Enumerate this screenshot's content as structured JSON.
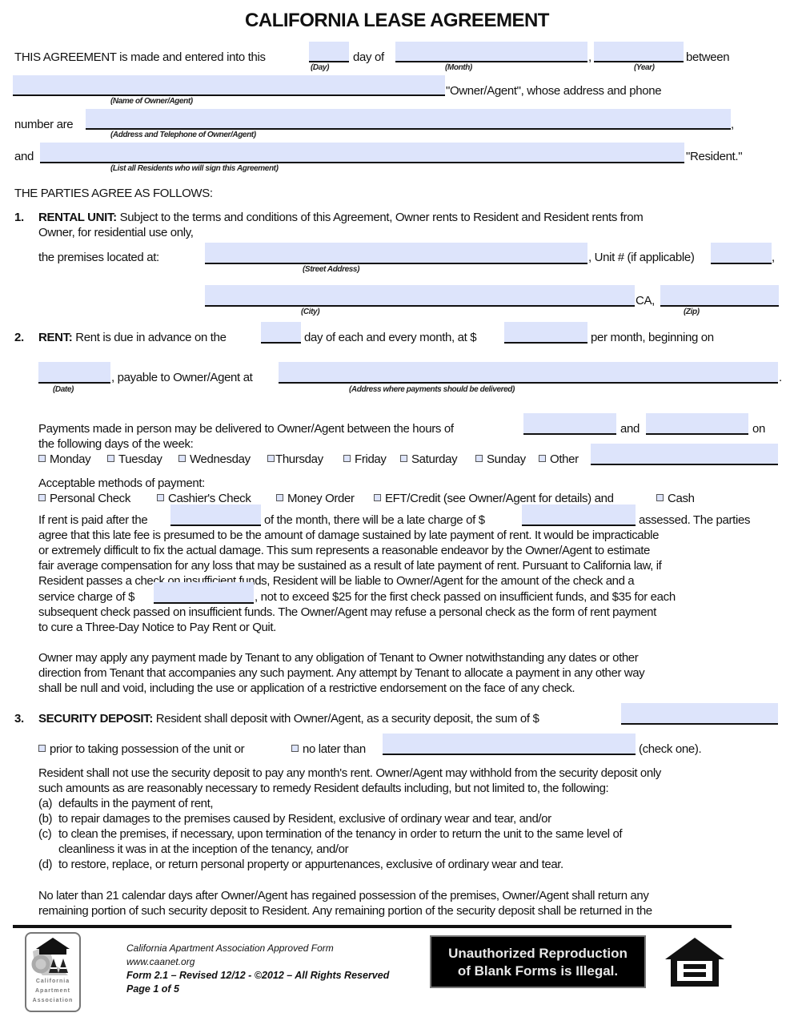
{
  "document": {
    "title": "CALIFORNIA LEASE AGREEMENT",
    "field_color": "#dde4fb",
    "intro": {
      "line1_a": "THIS AGREEMENT is made and entered into this",
      "line1_b": "day of",
      "line1_c": ",",
      "line1_d": "between",
      "cap_day": "(Day)",
      "cap_month": "(Month)",
      "cap_year": "(Year)",
      "line2_a": "\"Owner/Agent\", whose address and phone",
      "cap_owner": "(Name of Owner/Agent)",
      "line3_a": "number are",
      "line3_b": ",",
      "cap_address": "(Address and Telephone of Owner/Agent)",
      "line4_a": "and",
      "line4_b": "\"Resident.\"",
      "cap_residents": "(List all Residents who will sign this Agreement)",
      "parties": "THE PARTIES AGREE AS FOLLOWS:"
    },
    "section1": {
      "num": "1.",
      "heading": "RENTAL UNIT:",
      "text1": "Subject to the terms and conditions of this Agreement, Owner rents to Resident and Resident rents from",
      "text2": "Owner, for residential use only,",
      "premises": "the premises located at:",
      "unit": ", Unit # (if applicable)",
      "unit_end": ",",
      "cap_street": "(Street Address)",
      "ca": "CA,",
      "cap_city": "(City)",
      "cap_zip": "(Zip)"
    },
    "section2": {
      "num": "2.",
      "heading": "RENT:",
      "text1_a": "Rent is due in advance on the",
      "text1_b": "day of each and every month, at $",
      "text1_c": "per month, beginning on",
      "text2_a": ", payable to Owner/Agent at",
      "text2_b": ".",
      "cap_date": "(Date)",
      "cap_pay_address": "(Address where payments should be delivered)",
      "hours_a": "Payments made in person may be delivered to Owner/Agent between the hours of",
      "hours_b": "and",
      "hours_c": "on",
      "days_intro": "the following days of the week:",
      "days": [
        "Monday",
        "Tuesday",
        "Wednesday",
        "Thursday",
        "Friday",
        "Saturday",
        "Sunday",
        "Other"
      ],
      "methods_intro": "Acceptable methods of payment:",
      "methods": [
        "Personal Check",
        "Cashier's Check",
        "Money Order",
        "EFT/Credit (see Owner/Agent for details) and",
        "Cash"
      ],
      "late_a": "If rent is paid after the",
      "late_b": "of the month, there will be a late charge of $",
      "late_c": "assessed. The parties",
      "late_lines": [
        "agree that this late fee is presumed to be the amount of damage sustained by late payment of rent.  It would be impracticable",
        "or extremely difficult to fix the actual damage.  This sum represents a reasonable endeavor by the Owner/Agent to estimate",
        "fair average compensation for any loss that may be sustained as a result of late payment of rent. Pursuant to California law, if",
        "Resident passes a check on insufficient funds, Resident will be liable to Owner/Agent for the amount of the check and a"
      ],
      "service_a": "service charge of $",
      "service_b": ", not to exceed $25 for the first check passed on insufficient funds, and $35 for each",
      "service_lines": [
        "subsequent check passed on insufficient funds.  The Owner/Agent may refuse a personal check as the form of rent payment",
        "to cure a Three-Day Notice to Pay Rent or Quit."
      ],
      "apply_lines": [
        "Owner may apply any payment made by Tenant to any obligation of Tenant to Owner notwithstanding any dates or other",
        "direction from Tenant that accompanies any such payment. Any attempt by Tenant to allocate a payment in any other way",
        "shall be null and void, including the use or application of a restrictive endorsement on the face of any check."
      ]
    },
    "section3": {
      "num": "3.",
      "heading": "SECURITY DEPOSIT:",
      "text1": "Resident shall deposit with Owner/Agent, as a security deposit, the sum of $",
      "opt1": "prior to taking possession of the unit or",
      "opt2": "no later than",
      "check_one": "(check one).",
      "body_lines": [
        "Resident shall not use the security deposit to pay any month's rent. Owner/Agent may withhold from the security deposit only",
        "such amounts as are reasonably necessary to remedy Resident defaults including, but not limited to, the following:"
      ],
      "items": [
        {
          "label": "(a)",
          "text": "defaults in the payment of rent,"
        },
        {
          "label": "(b)",
          "text": "to repair damages to the premises caused by Resident, exclusive of ordinary wear and tear, and/or"
        },
        {
          "label": "(c)",
          "text": "to clean the premises, if necessary, upon termination of the tenancy in order to return the unit to the same level of"
        },
        {
          "label": "",
          "text": "cleanliness it was in at the inception of the tenancy, and/or"
        },
        {
          "label": "(d)",
          "text": "to restore, replace, or return personal property or appurtenances, exclusive of ordinary wear and tear."
        }
      ],
      "return_lines": [
        "No later than 21 calendar days after Owner/Agent has regained possession of the premises, Owner/Agent shall return any",
        "remaining portion of such security deposit to Resident.  Any remaining portion of the security deposit shall be returned in the"
      ]
    }
  },
  "footer": {
    "logo_lines": [
      "California",
      "Apartment",
      "Association"
    ],
    "logo_icon": "caa-logo-icon",
    "line1": "California Apartment Association Approved Form",
    "line2": "www.caanet.org",
    "line3": "Form 2.1 – Revised 12/12 - ©2012 – All Rights Reserved",
    "line4": "Page 1 of 5",
    "notice_line1": "Unauthorized Reproduction",
    "notice_line2": "of Blank Forms is Illegal.",
    "housing_icon": "equal-housing-icon"
  }
}
